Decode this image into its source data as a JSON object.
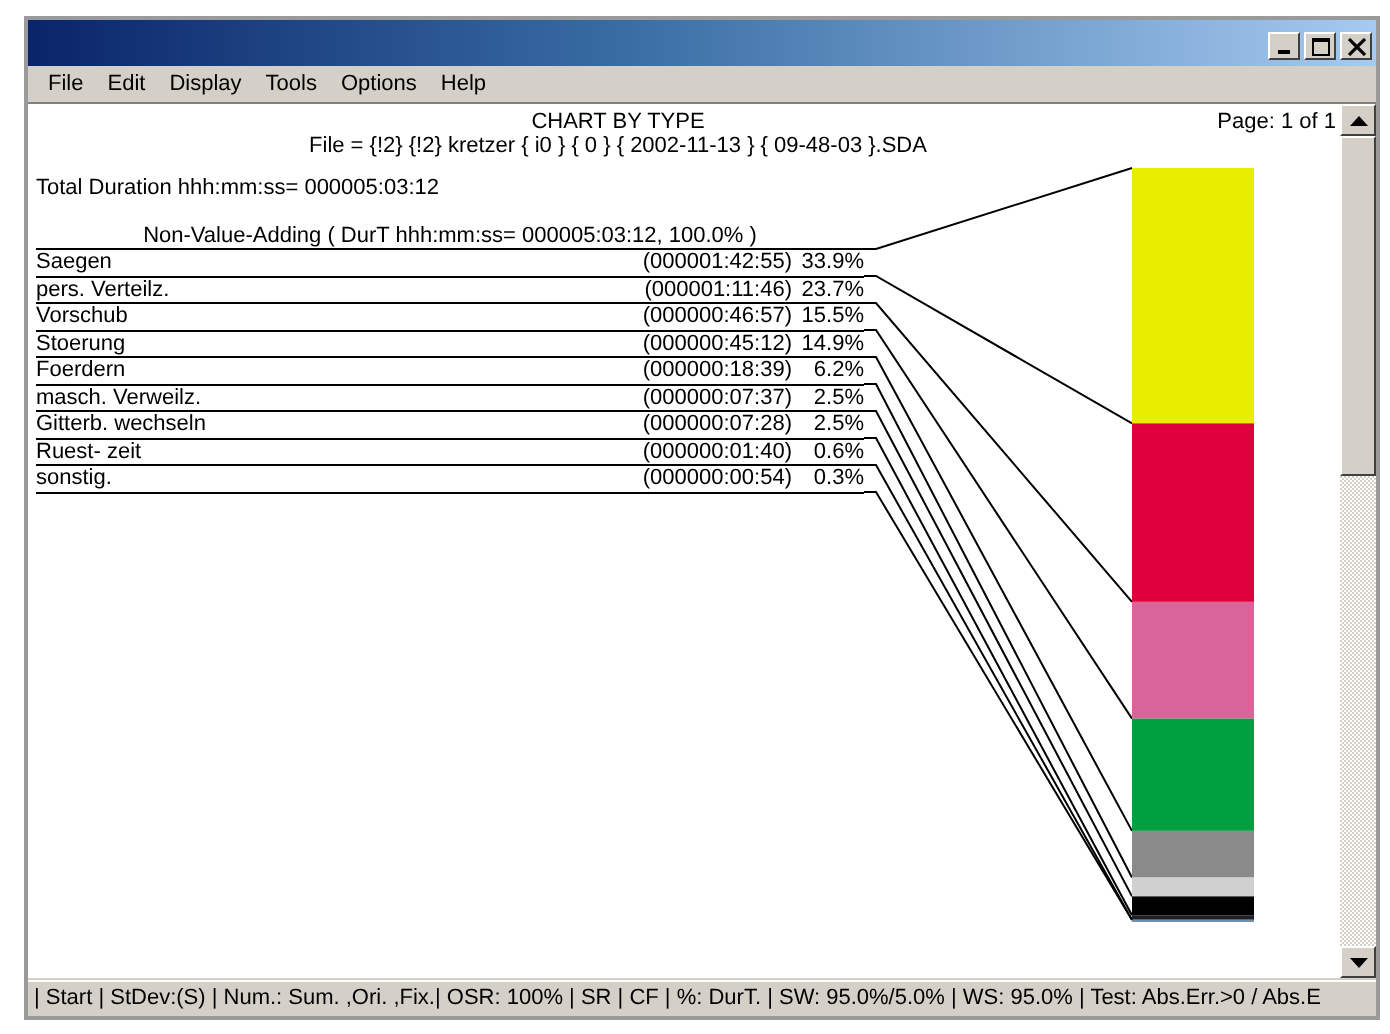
{
  "menu": [
    "File",
    "Edit",
    "Display",
    "Tools",
    "Options",
    "Help"
  ],
  "report": {
    "title": "CHART BY TYPE",
    "file": "File = {!2} {!2} kretzer { i0 } { 0 } { 2002-11-13 } { 09-48-03 }.SDA",
    "page": "Page:  1 of 1",
    "total": "Total Duration hhh:mm:ss= 000005:03:12",
    "group": "Non-Value-Adding ( DurT hhh:mm:ss= 000005:03:12, 100.0% )",
    "rows": [
      {
        "label": "Saegen",
        "duration": "(000001:42:55)",
        "percent": "33.9%"
      },
      {
        "label": "pers. Verteilz.",
        "duration": "(000001:11:46)",
        "percent": "23.7%"
      },
      {
        "label": "Vorschub",
        "duration": "(000000:46:57)",
        "percent": "15.5%"
      },
      {
        "label": "Stoerung",
        "duration": "(000000:45:12)",
        "percent": "14.9%"
      },
      {
        "label": "Foerdern",
        "duration": "(000000:18:39)",
        "percent": "6.2%"
      },
      {
        "label": "masch. Verweilz.",
        "duration": "(000000:07:37)",
        "percent": "2.5%"
      },
      {
        "label": "Gitterb. wechseln",
        "duration": "(000000:07:28)",
        "percent": "2.5%"
      },
      {
        "label": "Ruest- zeit",
        "duration": "(000000:01:40)",
        "percent": "0.6%"
      },
      {
        "label": "sonstig.",
        "duration": "(000000:00:54)",
        "percent": "0.3%"
      }
    ],
    "bar": {
      "segments": [
        {
          "color": "#e8ee00"
        },
        {
          "color": "#e0003c"
        },
        {
          "color": "#d9649a"
        },
        {
          "color": "#00a040"
        },
        {
          "color": "#8a8a8a"
        },
        {
          "color": "#d0d0d0"
        },
        {
          "color": "#000000"
        },
        {
          "color": "#202020"
        },
        {
          "color": "#7090b0"
        }
      ]
    }
  },
  "status_bar": "| Start | StDev:(S) | Num.: Sum. ,Ori. ,Fix.| OSR: 100% | SR | CF | %: DurT. | SW: 95.0%/5.0% | WS: 95.0% | Test: Abs.Err.>0 / Abs.E"
}
